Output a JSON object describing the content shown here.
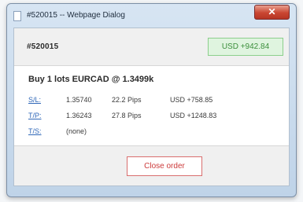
{
  "window": {
    "title": "#520015 -- Webpage Dialog",
    "doc_icon": "document-icon",
    "close_glyph": "✕",
    "close_icon": "close-icon"
  },
  "header": {
    "order_id": "#520015",
    "profit_badge": "USD +942.84"
  },
  "order": {
    "summary": "Buy 1 lots EURCAD @ 1.3499k"
  },
  "levels": [
    {
      "label": "S/L:",
      "price": "1.35740",
      "pips": "22.2 Pips",
      "usd": "USD +758.85"
    },
    {
      "label": "T/P:",
      "price": "1.36243",
      "pips": "27.8 Pips",
      "usd": "USD +1248.83"
    },
    {
      "label": "T/S:",
      "price": "(none)",
      "pips": "",
      "usd": ""
    }
  ],
  "footer": {
    "close_order_label": "Close order"
  },
  "colors": {
    "accent_blue": "#2f67b8",
    "profit_green": "#3c8f3c",
    "danger_red": "#cc3b3b"
  }
}
